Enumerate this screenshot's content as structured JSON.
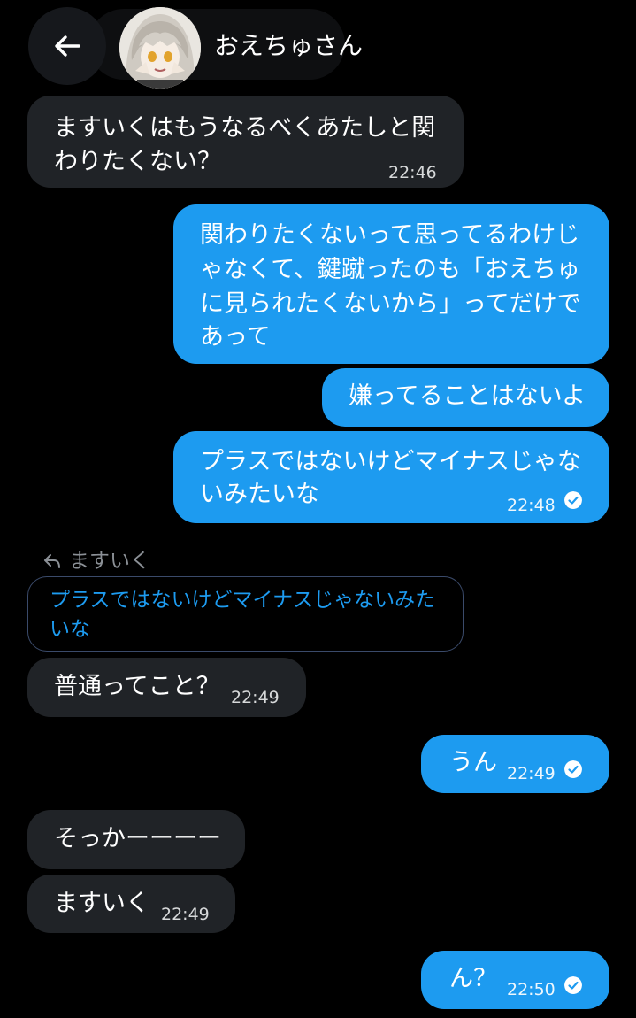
{
  "header": {
    "contact_name": "おえちゅさん",
    "back_icon": "arrow-left-icon"
  },
  "messages": [
    {
      "side": "in",
      "lines": [
        "ますいくはもうなるべくあたしと関",
        "わりたくない？"
      ],
      "time": "22:46"
    },
    {
      "side": "out",
      "lines": [
        "関わりたくないって思ってるわけじ",
        "ゃなくて、鍵蹴ったのも「おえちゅ",
        "に見られたくないから」ってだけで",
        "あって"
      ],
      "time": ""
    },
    {
      "side": "out",
      "lines": [
        "嫌ってることはないよ"
      ],
      "time": ""
    },
    {
      "side": "out",
      "lines": [
        "プラスではないけどマイナスじゃな",
        "いみたいな"
      ],
      "time": "22:48",
      "read": true
    },
    {
      "side": "in",
      "lines": [
        "普通ってこと？"
      ],
      "time": "22:49"
    },
    {
      "side": "out",
      "lines": [
        "うん"
      ],
      "time": "22:49",
      "read": true
    },
    {
      "side": "in",
      "lines": [
        "そっかーーーー"
      ],
      "time": ""
    },
    {
      "side": "in",
      "lines": [
        "ますいく"
      ],
      "time": "22:49"
    },
    {
      "side": "out",
      "lines": [
        "ん？"
      ],
      "time": "22:50",
      "read": true
    }
  ],
  "reply": {
    "context_label": "ますいく",
    "quoted_lines": [
      "プラスではないけどマイナスじゃないみた",
      "いな"
    ]
  },
  "colors": {
    "background": "#000000",
    "incoming_bubble": "#202327",
    "outgoing_bubble": "#1d9bf0",
    "quote_text": "#1d9bf0"
  }
}
